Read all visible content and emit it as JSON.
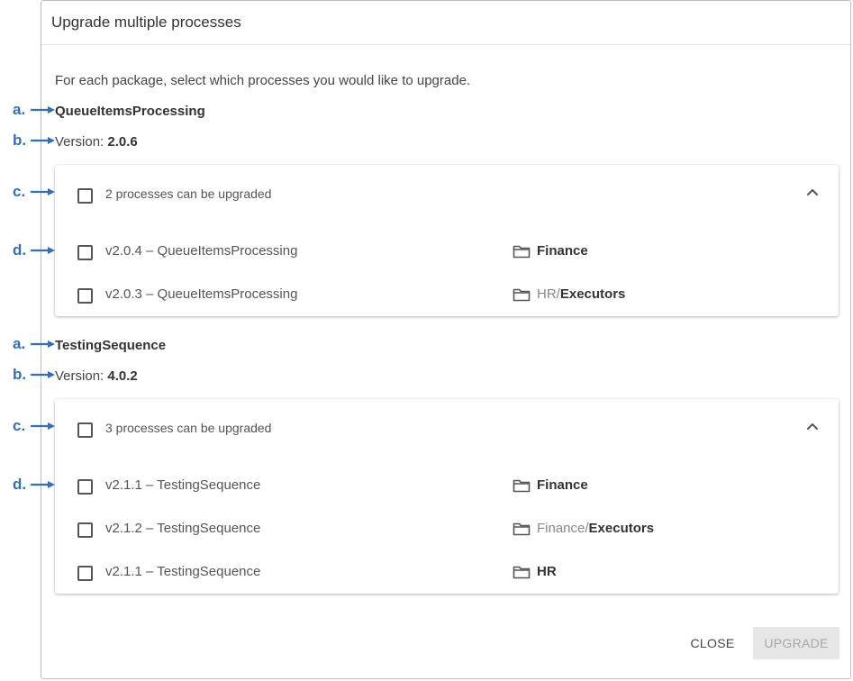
{
  "dialog": {
    "title": "Upgrade multiple processes",
    "intro": "For each package, select which processes you would like to upgrade.",
    "close_label": "CLOSE",
    "upgrade_label": "UPGRADE"
  },
  "annotations": {
    "a": "a.",
    "b": "b.",
    "c": "c.",
    "d": "d.",
    "color": "#2f6fc0"
  },
  "packages": [
    {
      "name": "QueueItemsProcessing",
      "version_label": "Version:",
      "version": "2.0.6",
      "summary": "2 processes can be upgraded",
      "processes": [
        {
          "label": "v2.0.4 – QueueItemsProcessing",
          "folder_parent": "",
          "folder_leaf": "Finance"
        },
        {
          "label": "v2.0.3 – QueueItemsProcessing",
          "folder_parent": "HR/",
          "folder_leaf": "Executors"
        }
      ]
    },
    {
      "name": "TestingSequence",
      "version_label": "Version:",
      "version": "4.0.2",
      "summary": "3 processes can be upgraded",
      "processes": [
        {
          "label": "v2.1.1 – TestingSequence",
          "folder_parent": "",
          "folder_leaf": "Finance"
        },
        {
          "label": "v2.1.2 – TestingSequence",
          "folder_parent": "Finance/",
          "folder_leaf": "Executors"
        },
        {
          "label": "v2.1.1 – TestingSequence",
          "folder_parent": "",
          "folder_leaf": "HR"
        }
      ]
    }
  ]
}
